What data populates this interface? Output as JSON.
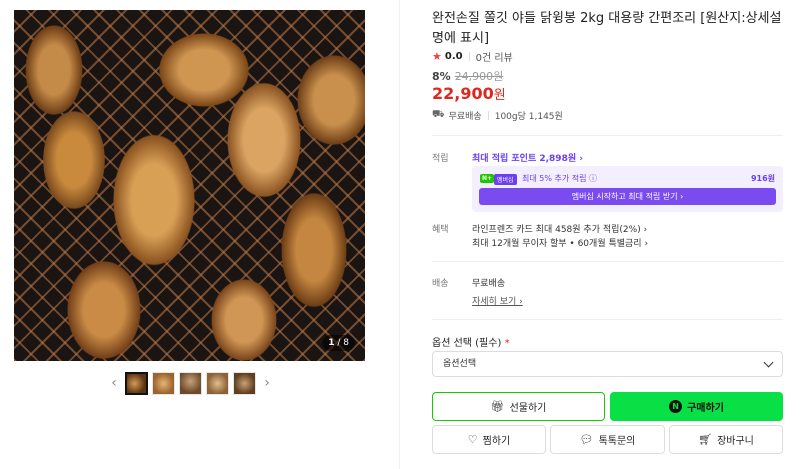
{
  "gallery": {
    "counter_current": "1",
    "counter_total": "/ 8",
    "prev_arrow": "‹",
    "next_arrow": "›"
  },
  "product": {
    "title": "완전손질 쫄깃 야들 닭윙봉 2kg 대용량 간편조리 [원산지:상세설명에 표시]",
    "rating": "0.0",
    "review_text": "0건 리뷰",
    "discount_rate": "8%",
    "original_price": "24,900원",
    "price": "22,900",
    "price_unit": "원",
    "shipping": "무료배송",
    "unit_price": "100g당 1,145원"
  },
  "points": {
    "label": "적립",
    "max_link": "최대 적립 포인트 2,898원 ›",
    "badge_n": "N+",
    "badge_member": "멤버십",
    "extra_text": "최대 5% 추가 적립 ⓘ",
    "extra_amount": "916원",
    "member_button": "멤버십 시작하고 최대 적립 받기 ›"
  },
  "benefits": {
    "label": "혜택",
    "line1": "라인프렌즈 카드 최대 458원 추가 적립(2%) ›",
    "line2": "최대 12개월 무이자 할부 • 60개월 특별금리 ›"
  },
  "delivery": {
    "label": "배송",
    "value": "무료배송",
    "detail_link": "자세히 보기 ›"
  },
  "options": {
    "label": "옵션 선택 (필수)",
    "required_mark": "*",
    "select_value": "옵션선택"
  },
  "actions": {
    "gift": "선물하기",
    "buy": "구매하기",
    "wish": "찜하기",
    "talk": "톡톡문의",
    "cart": "장바구니"
  },
  "colors": {
    "price_red": "#e0261d",
    "naver_green": "#09e046",
    "point_purple": "#6a3ff5"
  }
}
